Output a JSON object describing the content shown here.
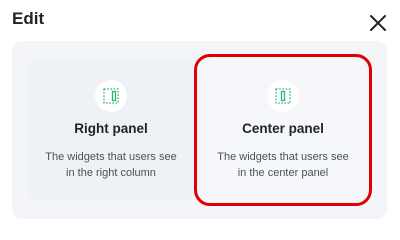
{
  "dialog": {
    "title": "Edit",
    "close_icon": "close-icon"
  },
  "options": [
    {
      "icon": "right-panel-layout-icon",
      "title": "Right panel",
      "description_line1": "The widgets that users see",
      "description_line2": "in the right column",
      "selected": false
    },
    {
      "icon": "center-panel-layout-icon",
      "title": "Center panel",
      "description_line1": "The widgets that users see",
      "description_line2": "in the center panel",
      "selected": true
    }
  ],
  "colors": {
    "accent_green": "#2bb673",
    "selected_border": "#e00000",
    "panel_bg": "#f3f5f8",
    "text_primary": "#1f2328",
    "text_secondary": "#4b5058"
  }
}
